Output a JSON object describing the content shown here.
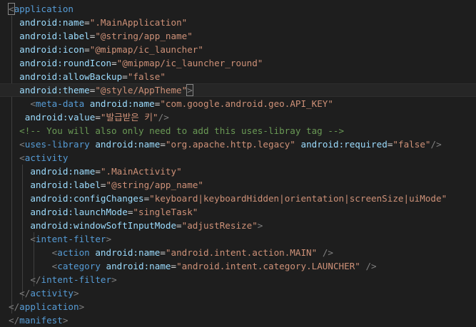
{
  "editor": {
    "lines": [
      [
        {
          "c": "punct",
          "t": "<"
        },
        {
          "c": "tag",
          "t": "application"
        }
      ],
      [
        {
          "c": "attr",
          "t": "  android:name"
        },
        {
          "c": "eq",
          "t": "="
        },
        {
          "c": "str",
          "t": "\".MainApplication\""
        }
      ],
      [
        {
          "c": "attr",
          "t": "  android:label"
        },
        {
          "c": "eq",
          "t": "="
        },
        {
          "c": "str",
          "t": "\"@string/app_name\""
        }
      ],
      [
        {
          "c": "attr",
          "t": "  android:icon"
        },
        {
          "c": "eq",
          "t": "="
        },
        {
          "c": "str",
          "t": "\"@mipmap/ic_launcher\""
        }
      ],
      [
        {
          "c": "attr",
          "t": "  android:roundIcon"
        },
        {
          "c": "eq",
          "t": "="
        },
        {
          "c": "str",
          "t": "\"@mipmap/ic_launcher_round\""
        }
      ],
      [
        {
          "c": "attr",
          "t": "  android:allowBackup"
        },
        {
          "c": "eq",
          "t": "="
        },
        {
          "c": "str",
          "t": "\"false\""
        }
      ],
      [
        {
          "c": "attr",
          "t": "  android:theme"
        },
        {
          "c": "eq",
          "t": "="
        },
        {
          "c": "str",
          "t": "\"@style/AppTheme\""
        },
        {
          "c": "punct",
          "t": ">"
        }
      ],
      [
        {
          "c": "punct",
          "t": "    <"
        },
        {
          "c": "tag",
          "t": "meta-data"
        },
        {
          "c": "attr",
          "t": " android:name"
        },
        {
          "c": "eq",
          "t": "="
        },
        {
          "c": "str",
          "t": "\"com.google.android.geo.API_KEY\""
        }
      ],
      [
        {
          "c": "attr",
          "t": "   android:value"
        },
        {
          "c": "eq",
          "t": "="
        },
        {
          "c": "str",
          "t": "\"발급받은 키\""
        },
        {
          "c": "punct",
          "t": "/>"
        }
      ],
      [
        {
          "c": "comment",
          "t": "  <!-- You will also only need to add this uses-libray tag -->"
        }
      ],
      [
        {
          "c": "punct",
          "t": "  <"
        },
        {
          "c": "tag",
          "t": "uses-library"
        },
        {
          "c": "attr",
          "t": " android:name"
        },
        {
          "c": "eq",
          "t": "="
        },
        {
          "c": "str",
          "t": "\"org.apache.http.legacy\""
        },
        {
          "c": "attr",
          "t": " android:required"
        },
        {
          "c": "eq",
          "t": "="
        },
        {
          "c": "str",
          "t": "\"false\""
        },
        {
          "c": "punct",
          "t": "/>"
        }
      ],
      [
        {
          "c": "punct",
          "t": "  <"
        },
        {
          "c": "tag",
          "t": "activity"
        }
      ],
      [
        {
          "c": "attr",
          "t": "    android:name"
        },
        {
          "c": "eq",
          "t": "="
        },
        {
          "c": "str",
          "t": "\".MainActivity\""
        }
      ],
      [
        {
          "c": "attr",
          "t": "    android:label"
        },
        {
          "c": "eq",
          "t": "="
        },
        {
          "c": "str",
          "t": "\"@string/app_name\""
        }
      ],
      [
        {
          "c": "attr",
          "t": "    android:configChanges"
        },
        {
          "c": "eq",
          "t": "="
        },
        {
          "c": "str",
          "t": "\"keyboard|keyboardHidden|orientation|screenSize|uiMode\""
        }
      ],
      [
        {
          "c": "attr",
          "t": "    android:launchMode"
        },
        {
          "c": "eq",
          "t": "="
        },
        {
          "c": "str",
          "t": "\"singleTask\""
        }
      ],
      [
        {
          "c": "attr",
          "t": "    android:windowSoftInputMode"
        },
        {
          "c": "eq",
          "t": "="
        },
        {
          "c": "str",
          "t": "\"adjustResize\""
        },
        {
          "c": "punct",
          "t": ">"
        }
      ],
      [
        {
          "c": "punct",
          "t": "    <"
        },
        {
          "c": "tag",
          "t": "intent-filter"
        },
        {
          "c": "punct",
          "t": ">"
        }
      ],
      [
        {
          "c": "punct",
          "t": "        <"
        },
        {
          "c": "tag",
          "t": "action"
        },
        {
          "c": "attr",
          "t": " android:name"
        },
        {
          "c": "eq",
          "t": "="
        },
        {
          "c": "str",
          "t": "\"android.intent.action.MAIN\""
        },
        {
          "c": "punct",
          "t": " />"
        }
      ],
      [
        {
          "c": "punct",
          "t": "        <"
        },
        {
          "c": "tag",
          "t": "category"
        },
        {
          "c": "attr",
          "t": " android:name"
        },
        {
          "c": "eq",
          "t": "="
        },
        {
          "c": "str",
          "t": "\"android.intent.category.LAUNCHER\""
        },
        {
          "c": "punct",
          "t": " />"
        }
      ],
      [
        {
          "c": "punct",
          "t": "    </"
        },
        {
          "c": "tag",
          "t": "intent-filter"
        },
        {
          "c": "punct",
          "t": ">"
        }
      ],
      [
        {
          "c": "punct",
          "t": "  </"
        },
        {
          "c": "tag",
          "t": "activity"
        },
        {
          "c": "punct",
          "t": ">"
        }
      ],
      [
        {
          "c": "punct",
          "t": "</"
        },
        {
          "c": "tag",
          "t": "application"
        },
        {
          "c": "punct",
          "t": ">"
        }
      ],
      [
        {
          "c": "punct",
          "t": "</"
        },
        {
          "c": "tag",
          "t": "manifest"
        },
        {
          "c": "punct",
          "t": ">"
        }
      ]
    ]
  }
}
